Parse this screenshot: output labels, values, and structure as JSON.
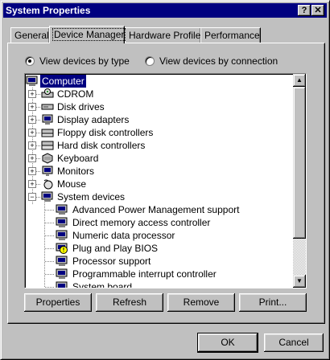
{
  "window": {
    "title": "System Properties",
    "help_glyph": "?",
    "close_glyph": "✕"
  },
  "tabs": [
    {
      "label": "General"
    },
    {
      "label": "Device Manager"
    },
    {
      "label": "Hardware Profiles"
    },
    {
      "label": "Performance"
    }
  ],
  "view_options": {
    "by_type": "View devices by type",
    "by_connection": "View devices by connection",
    "selected": "by_type"
  },
  "tree": {
    "root": {
      "label": "Computer",
      "icon": "computer-icon"
    },
    "categories": [
      {
        "label": "CDROM",
        "icon": "cdrom-icon",
        "expander": "+"
      },
      {
        "label": "Disk drives",
        "icon": "disk-drive-icon",
        "expander": "+"
      },
      {
        "label": "Display adapters",
        "icon": "display-adapter-icon",
        "expander": "+"
      },
      {
        "label": "Floppy disk controllers",
        "icon": "floppy-controller-icon",
        "expander": "+"
      },
      {
        "label": "Hard disk controllers",
        "icon": "hdd-controller-icon",
        "expander": "+"
      },
      {
        "label": "Keyboard",
        "icon": "keyboard-icon",
        "expander": "+"
      },
      {
        "label": "Monitors",
        "icon": "monitor-icon",
        "expander": "+"
      },
      {
        "label": "Mouse",
        "icon": "mouse-icon",
        "expander": "+"
      },
      {
        "label": "System devices",
        "icon": "system-device-icon",
        "expander": "−"
      }
    ],
    "system_devices": [
      {
        "label": "Advanced Power Management support",
        "icon": "system-device-icon"
      },
      {
        "label": "Direct memory access controller",
        "icon": "system-device-icon"
      },
      {
        "label": "Numeric data processor",
        "icon": "system-device-icon"
      },
      {
        "label": "Plug and Play BIOS",
        "icon": "warning-device-icon"
      },
      {
        "label": "Processor support",
        "icon": "system-device-icon"
      },
      {
        "label": "Programmable interrupt controller",
        "icon": "system-device-icon"
      },
      {
        "label": "System board",
        "icon": "system-device-icon"
      }
    ]
  },
  "actions": {
    "properties": "Properties",
    "refresh": "Refresh",
    "remove": "Remove",
    "print": "Print..."
  },
  "dialog": {
    "ok": "OK",
    "cancel": "Cancel"
  },
  "colors": {
    "title_bar": "#000080",
    "face": "#c0c0c0",
    "selection": "#000080"
  }
}
